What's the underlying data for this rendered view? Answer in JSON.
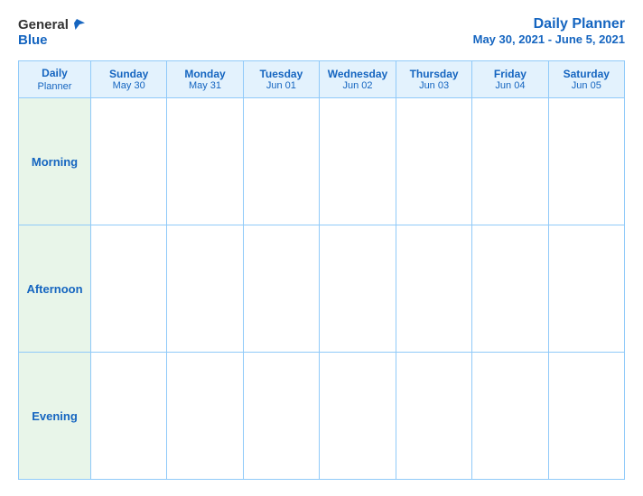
{
  "header": {
    "logo_general": "General",
    "logo_blue": "Blue",
    "title": "Daily Planner",
    "date_range": "May 30, 2021 - June 5, 2021"
  },
  "table": {
    "header_label": "Daily",
    "header_label2": "Planner",
    "columns": [
      {
        "day": "Sunday",
        "date": "May 30"
      },
      {
        "day": "Monday",
        "date": "May 31"
      },
      {
        "day": "Tuesday",
        "date": "Jun 01"
      },
      {
        "day": "Wednesday",
        "date": "Jun 02"
      },
      {
        "day": "Thursday",
        "date": "Jun 03"
      },
      {
        "day": "Friday",
        "date": "Jun 04"
      },
      {
        "day": "Saturday",
        "date": "Jun 05"
      }
    ],
    "rows": [
      {
        "label": "Morning"
      },
      {
        "label": "Afternoon"
      },
      {
        "label": "Evening"
      }
    ]
  }
}
